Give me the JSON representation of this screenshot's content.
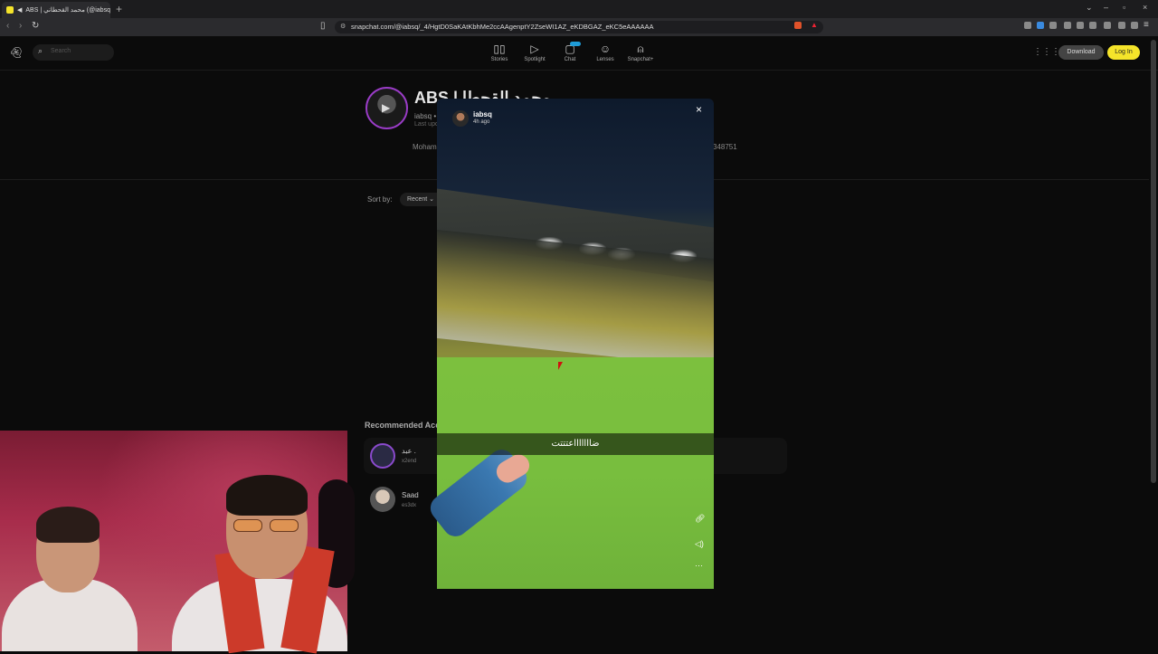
{
  "browser": {
    "tab_title": "ABS | محمد القحطاني (@iabsq",
    "tab_close": "×",
    "new_tab": "+",
    "url": "snapchat.com/@iabsq/_4/HgtD0SaKAtKbhMe2ccAAgenptY2ZseWI1AZ_eKDBGAZ_eKC5eAAAAAA",
    "win_min": "–",
    "win_max": "▫",
    "win_close": "×"
  },
  "snap": {
    "search_placeholder": "Search",
    "nav": [
      {
        "label": "Stories",
        "icon": "stories-icon"
      },
      {
        "label": "Spotlight",
        "icon": "play-icon"
      },
      {
        "label": "Chat",
        "icon": "chat-icon"
      },
      {
        "label": "Lenses",
        "icon": "lens-icon"
      },
      {
        "label": "Snapchat+",
        "icon": "ghost-plus-icon"
      }
    ],
    "download": "Download",
    "login": "Log In"
  },
  "profile": {
    "name": "ABS | محمد القحطا",
    "username": "iabsq •",
    "updated": "Last upd",
    "bio_start": "Moham",
    "bio_end": "348751",
    "sort_label": "Sort by:",
    "sort_value": "Recent",
    "recommended_title": "Recommended Acc",
    "recommended": [
      {
        "name": "عبد .",
        "user": "x2end"
      },
      {
        "name": "Saad",
        "user": "es3dx"
      }
    ]
  },
  "story": {
    "user": "iabsq",
    "time": "4h ago",
    "caption": "ضاااااااعتتتت",
    "close": "×"
  },
  "colors": {
    "accent": "#f5e42a",
    "chat_badge": "#1e9bd7",
    "avatar_ring": "#9a3cc7"
  }
}
